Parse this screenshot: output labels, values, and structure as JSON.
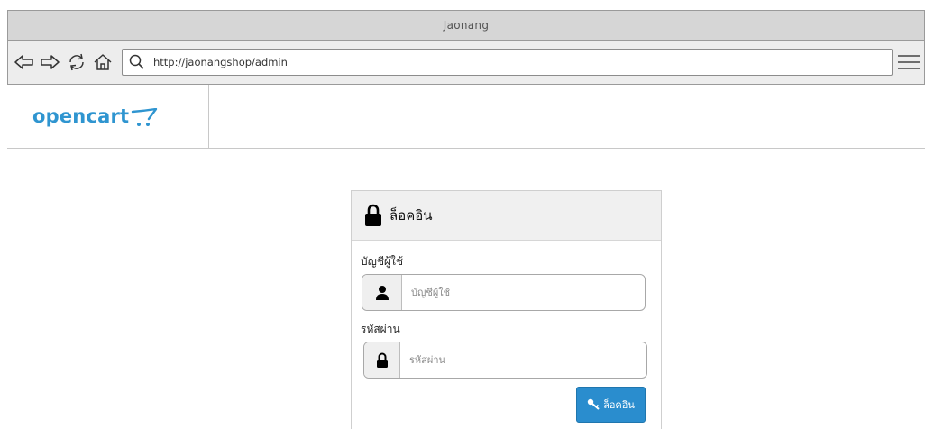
{
  "browser": {
    "window_title": "Jaonang",
    "address_url": "http://jaonangshop/admin",
    "nav_icons": [
      "back-arrow-icon",
      "forward-arrow-icon",
      "refresh-icon",
      "home-icon"
    ],
    "menu_icon": "hamburger-menu-icon"
  },
  "header": {
    "brand_name": "opencart",
    "brand_color": "#2f95d0"
  },
  "login": {
    "panel_title": "ล็อคอิน",
    "username_label": "บัญชีผู้ใช้",
    "username_placeholder": "บัญชีผู้ใช้",
    "username_value": "",
    "password_label": "รหัสผ่าน",
    "password_placeholder": "รหัสผ่าน",
    "password_value": "",
    "button_label": "ล็อคอิน",
    "button_color": "#2a8dce"
  }
}
